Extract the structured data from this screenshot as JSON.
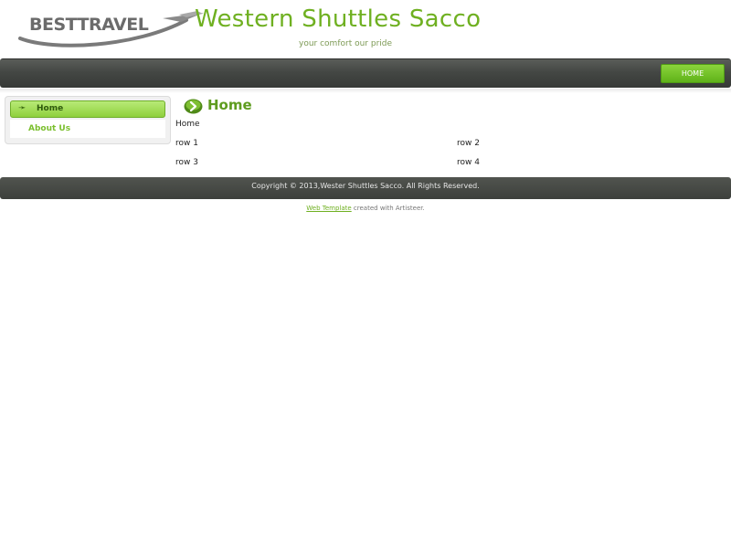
{
  "header": {
    "logo_text": "BESTTRAVEL",
    "site_title": "Western Shuttles Sacco",
    "slogan": "your comfort our pride"
  },
  "nav": {
    "home_label": "HOME"
  },
  "sidebar": {
    "items": [
      {
        "label": "Home"
      },
      {
        "label": "About Us"
      }
    ]
  },
  "content": {
    "title": "Home",
    "text": "Home",
    "rows": [
      "row 1",
      "row 2",
      "row 3",
      "row 4"
    ]
  },
  "footer": {
    "copyright": "Copyright © 2013,Wester Shuttles Sacco. All Rights Reserved.",
    "credit_link": "Web Template",
    "credit_text": " created with Artisteer."
  },
  "colors": {
    "brand_green": "#6fb021",
    "nav_dark": "#444744"
  }
}
